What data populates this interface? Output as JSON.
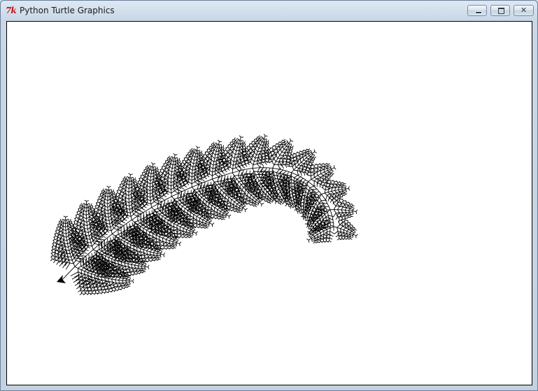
{
  "window": {
    "title": "Python Turtle Graphics",
    "logo_text": "7k",
    "buttons": {
      "minimize_icon": "minimize-icon",
      "maximize_icon": "maximize-icon",
      "close_icon": "close-icon",
      "close_glyph": "✕"
    }
  },
  "canvas": {
    "background": "#ffffff",
    "stroke": "#000000",
    "drawing": "fern-fractal",
    "turtle_icon": "turtle-arrow-icon"
  }
}
